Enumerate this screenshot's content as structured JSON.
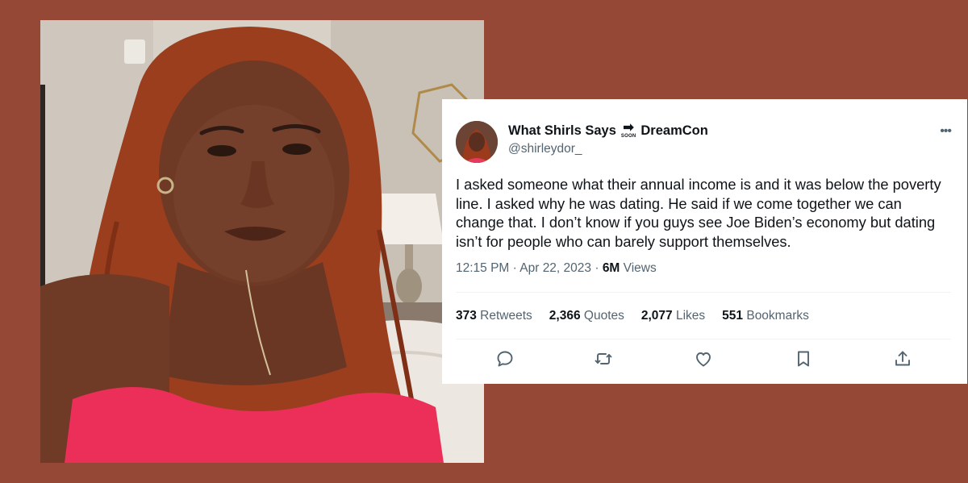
{
  "tweet": {
    "display_name_part1": "What Shirls Says",
    "badge_arrow": "➡",
    "badge_text": "SOON",
    "display_name_part2": "DreamCon",
    "handle": "@shirleydor_",
    "more": "•••",
    "text": "I asked someone what their annual income is and it was below the poverty line. I asked why he was dating. He said if we come together we can change that. I don’t know if you guys see Joe Biden’s economy but dating isn’t for people who can barely support themselves.",
    "time": "12:15 PM · Apr 22, 2023 · ",
    "views_count": "6M",
    "views_label": " Views",
    "stats": {
      "retweets_count": "373",
      "retweets_label": " Retweets",
      "quotes_count": "2,366",
      "quotes_label": " Quotes",
      "likes_count": "2,077",
      "likes_label": " Likes",
      "bookmarks_count": "551",
      "bookmarks_label": " Bookmarks"
    },
    "actions": [
      "reply-icon",
      "retweet-icon",
      "like-icon",
      "bookmark-icon",
      "share-icon"
    ]
  },
  "colors": {
    "background": "#964836",
    "text_primary": "#0f1419",
    "text_secondary": "#536471",
    "divider": "#eff3f4"
  }
}
